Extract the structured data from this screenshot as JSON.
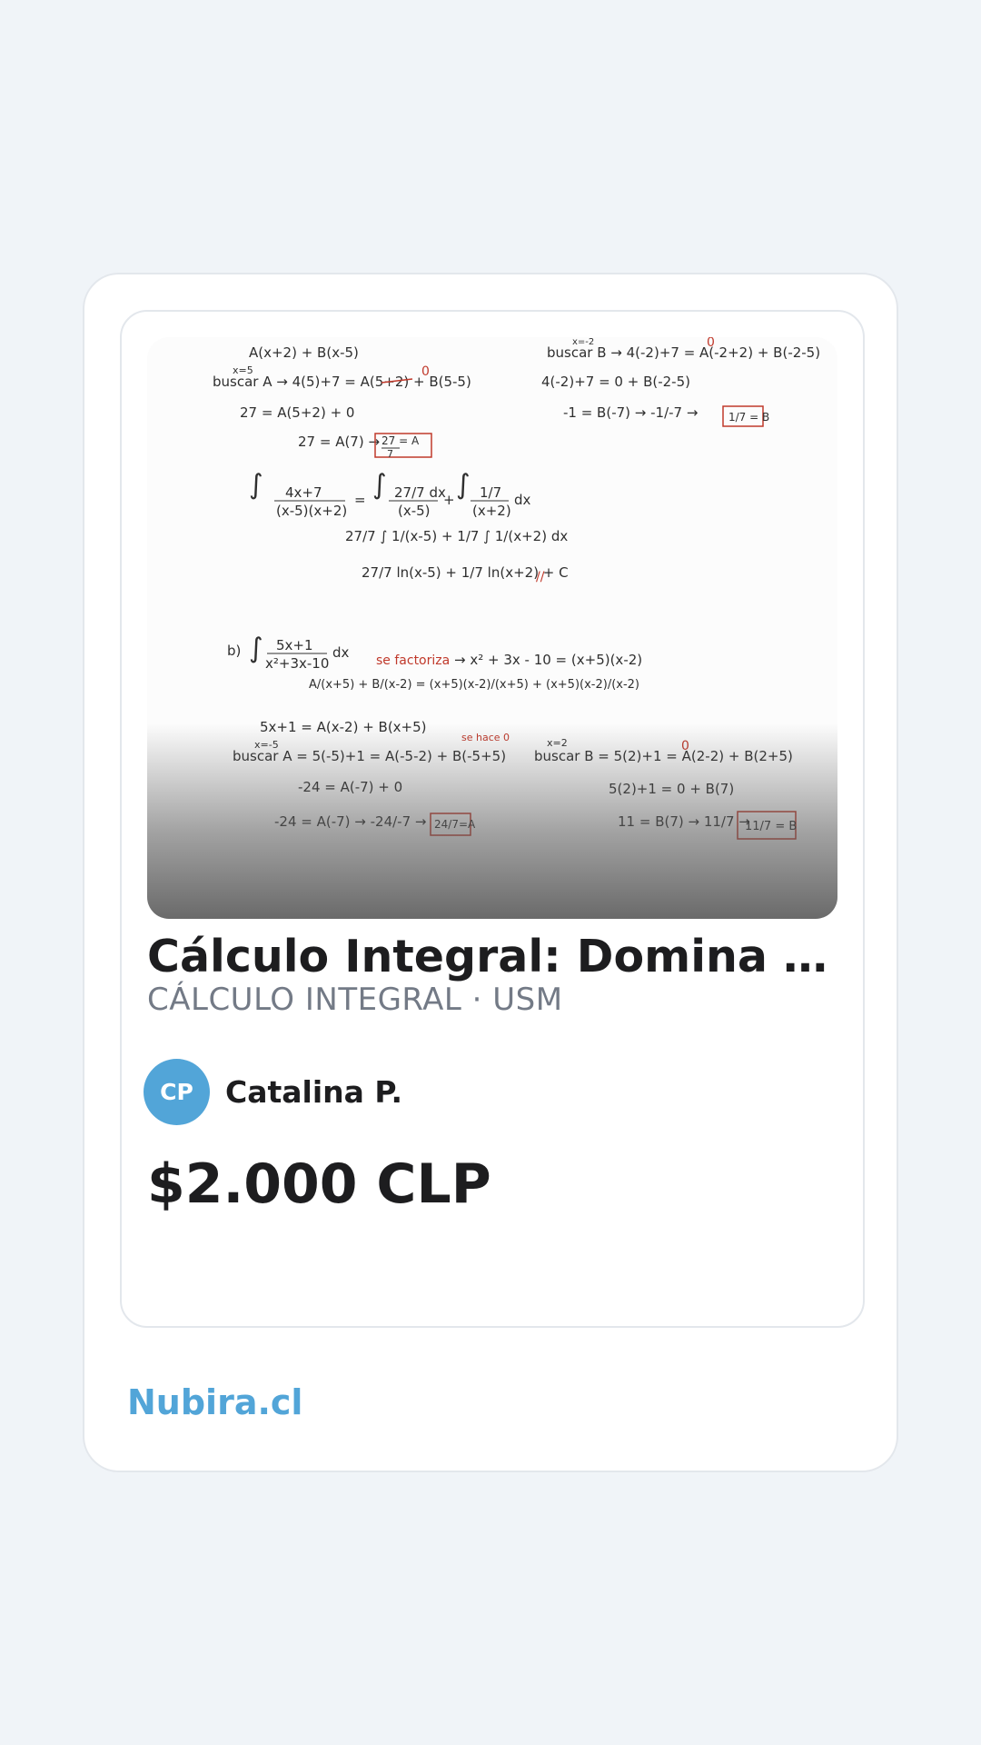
{
  "listing": {
    "title": "Cálculo Integral: Domina las...",
    "subtitle": "CÁLCULO INTEGRAL · USM",
    "author": {
      "initials": "CP",
      "name": "Catalina P."
    },
    "price": "$2.000 CLP"
  },
  "footer": {
    "brand": "Nubira.cl"
  },
  "colors": {
    "accent": "#52a5d8",
    "background": "#f0f4f8",
    "text": "#1d1d1f",
    "muted": "#737a86"
  }
}
